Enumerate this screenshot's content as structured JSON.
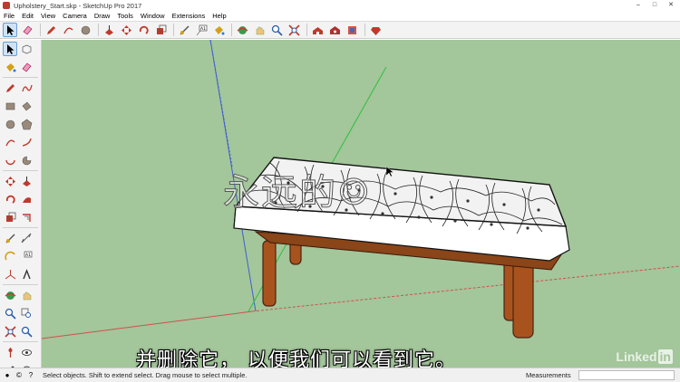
{
  "window": {
    "title": "Upholstery_Start.skp - SketchUp Pro 2017",
    "controls": [
      "–",
      "□",
      "✕"
    ]
  },
  "menu": [
    "File",
    "Edit",
    "View",
    "Camera",
    "Draw",
    "Tools",
    "Window",
    "Extensions",
    "Help"
  ],
  "toolbar_icons": [
    "select-icon",
    "eraser-icon",
    "pencil-icon",
    "arc-icon",
    "shape-icon",
    "push-pull-icon",
    "move-icon",
    "rotate-icon",
    "scale-icon",
    "offset-icon",
    "tape-measure-icon",
    "text-icon",
    "paint-bucket-icon",
    "orbit-icon",
    "pan-icon",
    "zoom-icon",
    "zoom-extents-icon",
    "warehouse-icon",
    "extension-warehouse-icon",
    "layout-icon",
    "ruby-icon"
  ],
  "viewport": {
    "background": "#a3c69a",
    "watermark": "永远的☺",
    "subtitle": "并删除它，  以便我们可以看到它。",
    "brand": "Linked",
    "brand_in": "in"
  },
  "status": {
    "hint": "Select objects. Shift to extend select. Drag mouse to select multiple.",
    "measurements_label": "Measurements",
    "measurements_value": ""
  }
}
